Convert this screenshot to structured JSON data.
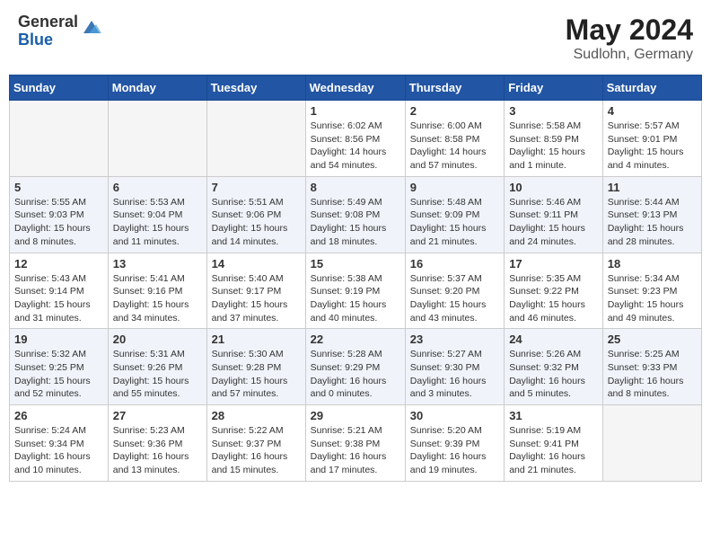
{
  "header": {
    "logo_general": "General",
    "logo_blue": "Blue",
    "month_year": "May 2024",
    "location": "Sudlohn, Germany"
  },
  "days_of_week": [
    "Sunday",
    "Monday",
    "Tuesday",
    "Wednesday",
    "Thursday",
    "Friday",
    "Saturday"
  ],
  "weeks": [
    [
      {
        "day": "",
        "content": ""
      },
      {
        "day": "",
        "content": ""
      },
      {
        "day": "",
        "content": ""
      },
      {
        "day": "1",
        "content": "Sunrise: 6:02 AM\nSunset: 8:56 PM\nDaylight: 14 hours\nand 54 minutes."
      },
      {
        "day": "2",
        "content": "Sunrise: 6:00 AM\nSunset: 8:58 PM\nDaylight: 14 hours\nand 57 minutes."
      },
      {
        "day": "3",
        "content": "Sunrise: 5:58 AM\nSunset: 8:59 PM\nDaylight: 15 hours\nand 1 minute."
      },
      {
        "day": "4",
        "content": "Sunrise: 5:57 AM\nSunset: 9:01 PM\nDaylight: 15 hours\nand 4 minutes."
      }
    ],
    [
      {
        "day": "5",
        "content": "Sunrise: 5:55 AM\nSunset: 9:03 PM\nDaylight: 15 hours\nand 8 minutes."
      },
      {
        "day": "6",
        "content": "Sunrise: 5:53 AM\nSunset: 9:04 PM\nDaylight: 15 hours\nand 11 minutes."
      },
      {
        "day": "7",
        "content": "Sunrise: 5:51 AM\nSunset: 9:06 PM\nDaylight: 15 hours\nand 14 minutes."
      },
      {
        "day": "8",
        "content": "Sunrise: 5:49 AM\nSunset: 9:08 PM\nDaylight: 15 hours\nand 18 minutes."
      },
      {
        "day": "9",
        "content": "Sunrise: 5:48 AM\nSunset: 9:09 PM\nDaylight: 15 hours\nand 21 minutes."
      },
      {
        "day": "10",
        "content": "Sunrise: 5:46 AM\nSunset: 9:11 PM\nDaylight: 15 hours\nand 24 minutes."
      },
      {
        "day": "11",
        "content": "Sunrise: 5:44 AM\nSunset: 9:13 PM\nDaylight: 15 hours\nand 28 minutes."
      }
    ],
    [
      {
        "day": "12",
        "content": "Sunrise: 5:43 AM\nSunset: 9:14 PM\nDaylight: 15 hours\nand 31 minutes."
      },
      {
        "day": "13",
        "content": "Sunrise: 5:41 AM\nSunset: 9:16 PM\nDaylight: 15 hours\nand 34 minutes."
      },
      {
        "day": "14",
        "content": "Sunrise: 5:40 AM\nSunset: 9:17 PM\nDaylight: 15 hours\nand 37 minutes."
      },
      {
        "day": "15",
        "content": "Sunrise: 5:38 AM\nSunset: 9:19 PM\nDaylight: 15 hours\nand 40 minutes."
      },
      {
        "day": "16",
        "content": "Sunrise: 5:37 AM\nSunset: 9:20 PM\nDaylight: 15 hours\nand 43 minutes."
      },
      {
        "day": "17",
        "content": "Sunrise: 5:35 AM\nSunset: 9:22 PM\nDaylight: 15 hours\nand 46 minutes."
      },
      {
        "day": "18",
        "content": "Sunrise: 5:34 AM\nSunset: 9:23 PM\nDaylight: 15 hours\nand 49 minutes."
      }
    ],
    [
      {
        "day": "19",
        "content": "Sunrise: 5:32 AM\nSunset: 9:25 PM\nDaylight: 15 hours\nand 52 minutes."
      },
      {
        "day": "20",
        "content": "Sunrise: 5:31 AM\nSunset: 9:26 PM\nDaylight: 15 hours\nand 55 minutes."
      },
      {
        "day": "21",
        "content": "Sunrise: 5:30 AM\nSunset: 9:28 PM\nDaylight: 15 hours\nand 57 minutes."
      },
      {
        "day": "22",
        "content": "Sunrise: 5:28 AM\nSunset: 9:29 PM\nDaylight: 16 hours\nand 0 minutes."
      },
      {
        "day": "23",
        "content": "Sunrise: 5:27 AM\nSunset: 9:30 PM\nDaylight: 16 hours\nand 3 minutes."
      },
      {
        "day": "24",
        "content": "Sunrise: 5:26 AM\nSunset: 9:32 PM\nDaylight: 16 hours\nand 5 minutes."
      },
      {
        "day": "25",
        "content": "Sunrise: 5:25 AM\nSunset: 9:33 PM\nDaylight: 16 hours\nand 8 minutes."
      }
    ],
    [
      {
        "day": "26",
        "content": "Sunrise: 5:24 AM\nSunset: 9:34 PM\nDaylight: 16 hours\nand 10 minutes."
      },
      {
        "day": "27",
        "content": "Sunrise: 5:23 AM\nSunset: 9:36 PM\nDaylight: 16 hours\nand 13 minutes."
      },
      {
        "day": "28",
        "content": "Sunrise: 5:22 AM\nSunset: 9:37 PM\nDaylight: 16 hours\nand 15 minutes."
      },
      {
        "day": "29",
        "content": "Sunrise: 5:21 AM\nSunset: 9:38 PM\nDaylight: 16 hours\nand 17 minutes."
      },
      {
        "day": "30",
        "content": "Sunrise: 5:20 AM\nSunset: 9:39 PM\nDaylight: 16 hours\nand 19 minutes."
      },
      {
        "day": "31",
        "content": "Sunrise: 5:19 AM\nSunset: 9:41 PM\nDaylight: 16 hours\nand 21 minutes."
      },
      {
        "day": "",
        "content": ""
      }
    ]
  ]
}
